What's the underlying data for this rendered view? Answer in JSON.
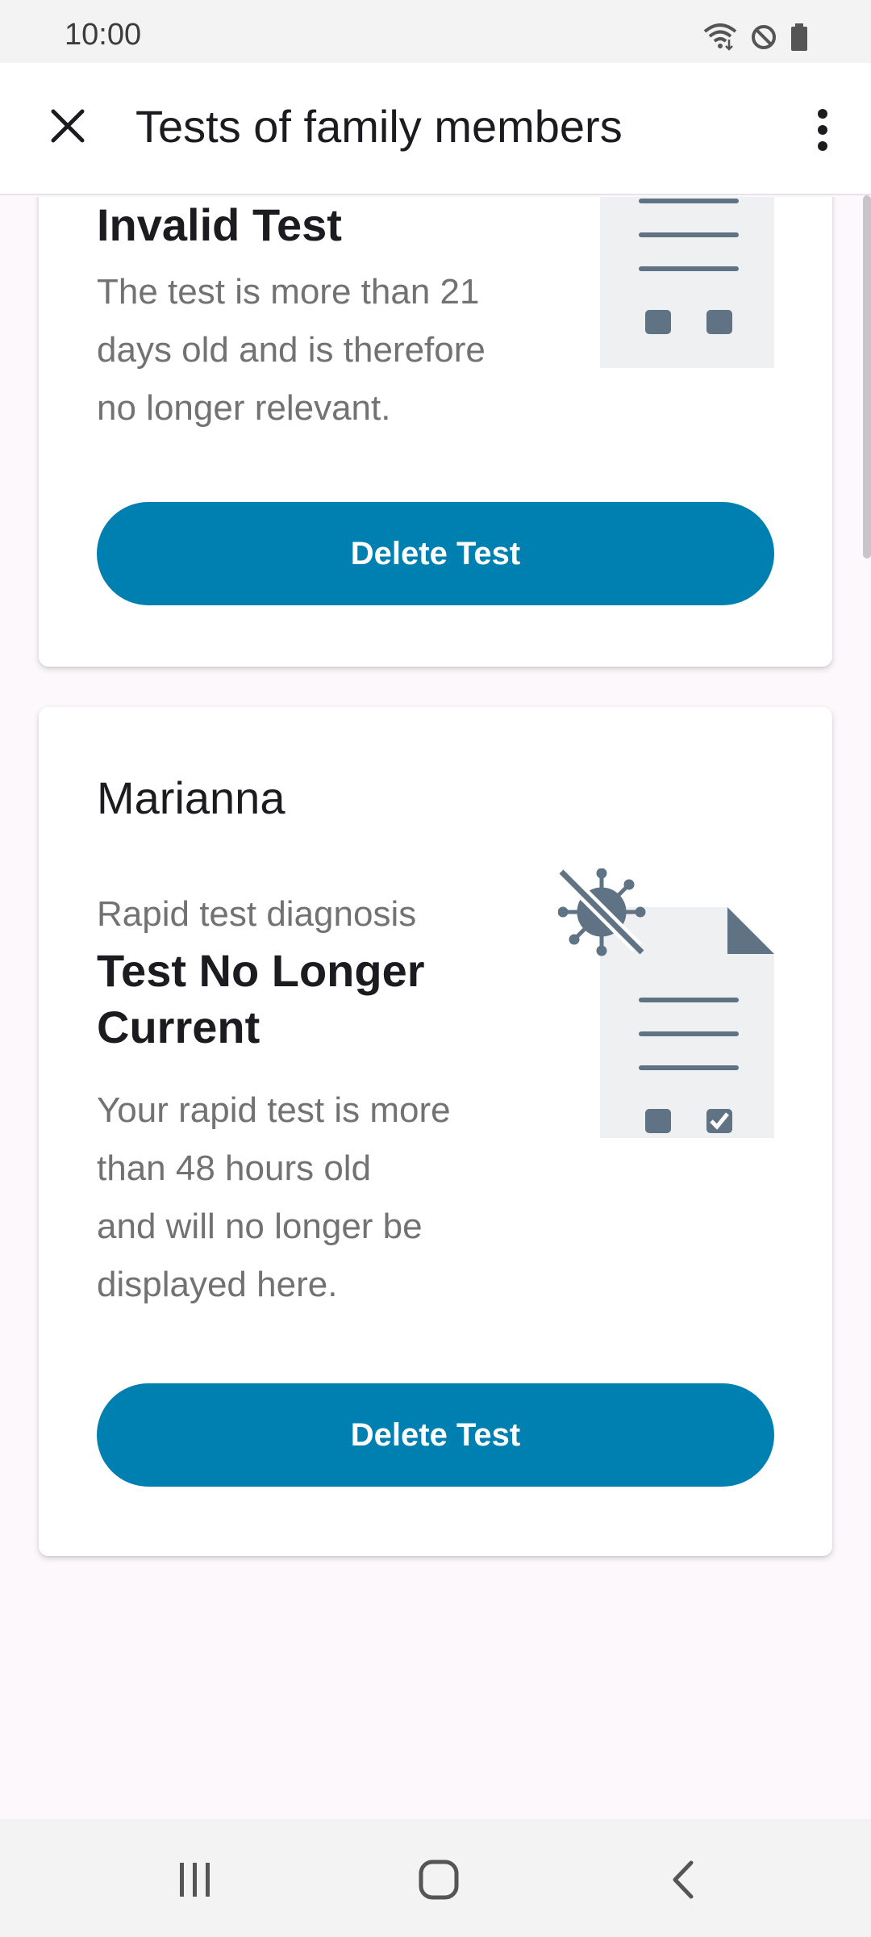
{
  "status_bar": {
    "time": "10:00",
    "icons": [
      "wifi-icon",
      "do-not-disturb-icon",
      "battery-icon"
    ]
  },
  "app_bar": {
    "title": "Tests of family members",
    "close_icon": "close-icon",
    "more_icon": "more-vert-icon"
  },
  "cards": [
    {
      "result_title": "Invalid Test",
      "description": "The test is more than 21 days old and is therefore no longer relevant.",
      "button_label": "Delete Test",
      "illustration": "document-illustration"
    },
    {
      "name": "Marianna",
      "result_label": "Rapid test diagnosis",
      "result_title": "Test No Longer Current",
      "description_lines": [
        "Your rapid test is more",
        "than 48 hours old",
        "and will no longer be",
        "displayed here."
      ],
      "button_label": "Delete Test",
      "illustration": "crossed-virus-document-illustration"
    }
  ],
  "colors": {
    "accent": "#0080b0",
    "illustration_gray": "#5f7384",
    "illustration_bg": "#eef0f2"
  },
  "nav_bar": {
    "icons": [
      "recent-apps-icon",
      "home-icon",
      "back-icon"
    ]
  }
}
